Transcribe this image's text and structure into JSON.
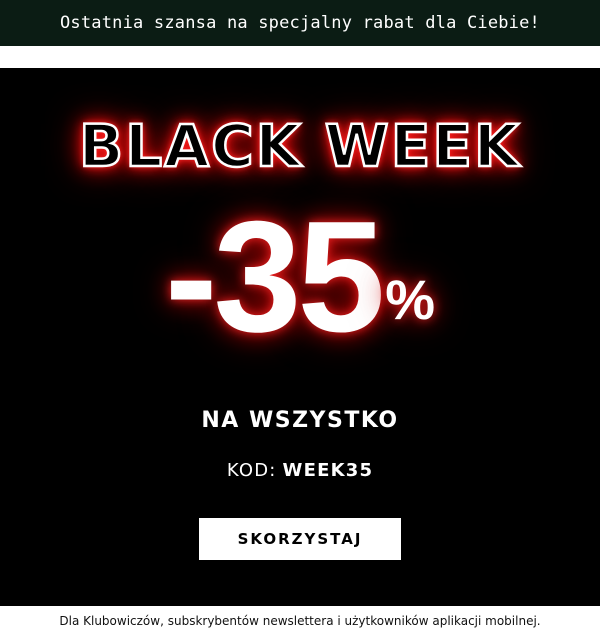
{
  "top_bar": {
    "text": "Ostatnia szansa na specjalny rabat dla Ciebie!"
  },
  "hero": {
    "title": "BLACK WEEK",
    "discount_value": "-35",
    "discount_unit": "%",
    "subtitle": "NA WSZYSTKO",
    "code_label": "KOD:",
    "code_value": "WEEK35",
    "cta_label": "SKORZYSTAJ"
  },
  "footer": {
    "note": "Dla Klubowiczów, subskrybentów newslettera i użytkowników aplikacji mobilnej."
  },
  "colors": {
    "background": "#000000",
    "top_bar": "#0b1c14",
    "neon_glow": "#ff1a1a",
    "cta_bg": "#ffffff"
  }
}
